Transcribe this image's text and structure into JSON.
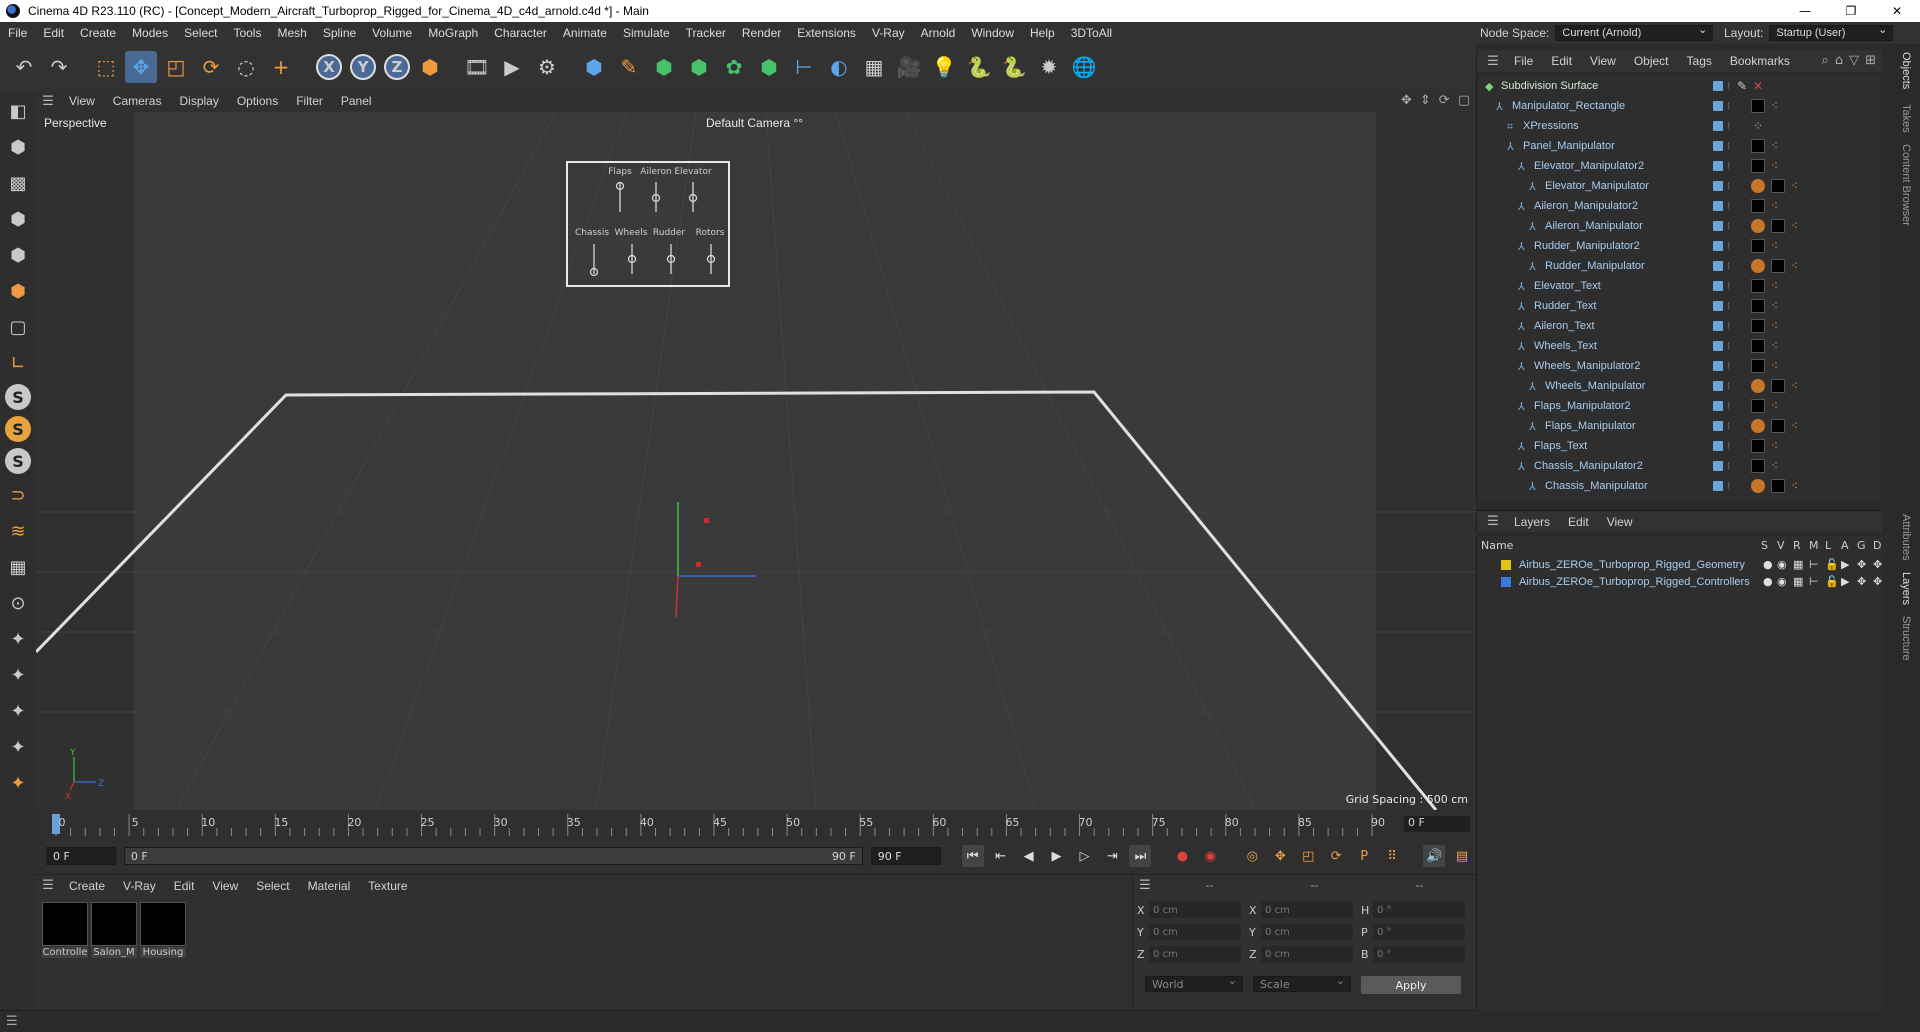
{
  "window": {
    "title": "Cinema 4D R23.110 (RC) - [Concept_Modern_Aircraft_Turboprop_Rigged_for_Cinema_4D_c4d_arnold.c4d *] - Main",
    "minimize": "—",
    "maximize": "❐",
    "close": "✕"
  },
  "menu": [
    "File",
    "Edit",
    "Create",
    "Modes",
    "Select",
    "Tools",
    "Mesh",
    "Spline",
    "Volume",
    "MoGraph",
    "Character",
    "Animate",
    "Simulate",
    "Tracker",
    "Render",
    "Extensions",
    "V-Ray",
    "Arnold",
    "Window",
    "Help",
    "3DToAll"
  ],
  "nodespace": {
    "label": "Node Space:",
    "value": "Current (Arnold)"
  },
  "layout": {
    "label": "Layout:",
    "value": "Startup (User)"
  },
  "toolbar": {
    "undo": "↶",
    "redo": "↷",
    "select": "⬚",
    "move": "✥",
    "scale": "◰",
    "rotate": "⟳",
    "last": "◌",
    "transform": "+",
    "x": "X",
    "y": "Y",
    "z": "Z",
    "coord": "⬢",
    "render1": "🎞",
    "render2": "▶",
    "render3": "⚙",
    "cube": "⬢",
    "pen": "✎",
    "gen1": "⬢",
    "gen2": "⬢",
    "gen3": "✿",
    "gen4": "⬢",
    "deform": "⊢",
    "field": "◐",
    "floor": "▦",
    "camera": "🎥",
    "light": "💡",
    "py1": "🐍",
    "py2": "🐍",
    "settings": "✹",
    "globe": "🌐"
  },
  "lefttools": {
    "t1": "◧",
    "t2": "⬢",
    "t3": "▩",
    "t4": "⬢",
    "t5": "⬢",
    "t6": "⬢",
    "t7": "▢",
    "t8": "∟",
    "s1": "S",
    "s2": "S",
    "s3": "S",
    "t9": "⊃",
    "t10": "≋",
    "t11": "▦",
    "t12": "⊙",
    "t13": "✦",
    "t14": "✦",
    "t15": "✦",
    "t16": "✦",
    "t17": "✦"
  },
  "viewport": {
    "menu": [
      "View",
      "Cameras",
      "Display",
      "Options",
      "Filter",
      "Panel"
    ],
    "name": "Perspective",
    "camera": "Default Camera",
    "camera_icon": "°°",
    "grid_spacing": "Grid Spacing : 500 cm",
    "icons": {
      "move": "✥",
      "dolly": "⇕",
      "rotate": "⟳",
      "max": "▢"
    },
    "panel_labels_top": [
      "Flaps",
      "Aileron",
      "Elevator"
    ],
    "panel_labels_bottom": [
      "Chassis",
      "Wheels",
      "Rudder",
      "Rotors"
    ],
    "axis": {
      "y": "Y",
      "z": "Z",
      "x": "X"
    }
  },
  "timeline": {
    "ticks": [
      "0",
      "5",
      "10",
      "15",
      "20",
      "25",
      "30",
      "35",
      "40",
      "45",
      "50",
      "55",
      "60",
      "65",
      "70",
      "75",
      "80",
      "85",
      "90"
    ],
    "current_frame": "0 F",
    "start": "0 F",
    "range_start": "0 F",
    "range_end": "90 F",
    "end": "90 F"
  },
  "transport": {
    "first": "⏮",
    "prev_key": "⇤",
    "prev": "◀",
    "play": "▶",
    "next": "▷",
    "next_key": "⇥",
    "last": "⏭",
    "rec": "●",
    "auto": "◉",
    "key": "◎",
    "pos": "✥",
    "scale": "◰",
    "rot": "⟳",
    "param": "P",
    "pla": "⠿",
    "motion": "🔊",
    "timeline": "▤"
  },
  "materials": {
    "menu": [
      "Create",
      "V-Ray",
      "Edit",
      "View",
      "Select",
      "Material",
      "Texture"
    ],
    "items": [
      "Controlle",
      "Salon_M",
      "Housing"
    ]
  },
  "coords": {
    "headers": [
      "--",
      "--",
      "--"
    ],
    "rows": [
      {
        "l1": "X",
        "v1": "0 cm",
        "l2": "X",
        "v2": "0 cm",
        "l3": "H",
        "v3": "0 °"
      },
      {
        "l1": "Y",
        "v1": "0 cm",
        "l2": "Y",
        "v2": "0 cm",
        "l3": "P",
        "v3": "0 °"
      },
      {
        "l1": "Z",
        "v1": "0 cm",
        "l2": "Z",
        "v2": "0 cm",
        "l3": "B",
        "v3": "0 °"
      }
    ],
    "world": "World",
    "scale": "Scale",
    "apply": "Apply"
  },
  "objects": {
    "menu": [
      "File",
      "Edit",
      "View",
      "Object",
      "Tags",
      "Bookmarks"
    ],
    "items": [
      {
        "name": "Subdivision Surface",
        "depth": 0,
        "color": "#7fd27f"
      },
      {
        "name": "Manipulator_Rectangle",
        "depth": 1
      },
      {
        "name": "XPressions",
        "depth": 2
      },
      {
        "name": "Panel_Manipulator",
        "depth": 2
      },
      {
        "name": "Elevator_Manipulator2",
        "depth": 3
      },
      {
        "name": "Elevator_Manipulator",
        "depth": 4
      },
      {
        "name": "Aileron_Manipulator2",
        "depth": 3
      },
      {
        "name": "Aileron_Manipulator",
        "depth": 4
      },
      {
        "name": "Rudder_Manipulator2",
        "depth": 3
      },
      {
        "name": "Rudder_Manipulator",
        "depth": 4
      },
      {
        "name": "Elevator_Text",
        "depth": 3
      },
      {
        "name": "Rudder_Text",
        "depth": 3
      },
      {
        "name": "Aileron_Text",
        "depth": 3
      },
      {
        "name": "Wheels_Text",
        "depth": 3
      },
      {
        "name": "Wheels_Manipulator2",
        "depth": 3
      },
      {
        "name": "Wheels_Manipulator",
        "depth": 4
      },
      {
        "name": "Flaps_Manipulator2",
        "depth": 3
      },
      {
        "name": "Flaps_Manipulator",
        "depth": 4
      },
      {
        "name": "Flaps_Text",
        "depth": 3
      },
      {
        "name": "Chassis_Manipulator2",
        "depth": 3
      },
      {
        "name": "Chassis_Manipulator",
        "depth": 4
      }
    ]
  },
  "layers": {
    "menu": [
      "Layers",
      "Edit",
      "View"
    ],
    "col_name": "Name",
    "cols": [
      "S",
      "V",
      "R",
      "M",
      "L",
      "A",
      "G",
      "D"
    ],
    "items": [
      {
        "name": "Airbus_ZEROe_Turboprop_Rigged_Geometry",
        "color": "#e2c418"
      },
      {
        "name": "Airbus_ZEROe_Turboprop_Rigged_Controllers",
        "color": "#3b7ad6"
      }
    ]
  },
  "vtabs": [
    "Objects",
    "Takes",
    "Content Browser",
    "Attributes",
    "Layers",
    "Structure"
  ]
}
